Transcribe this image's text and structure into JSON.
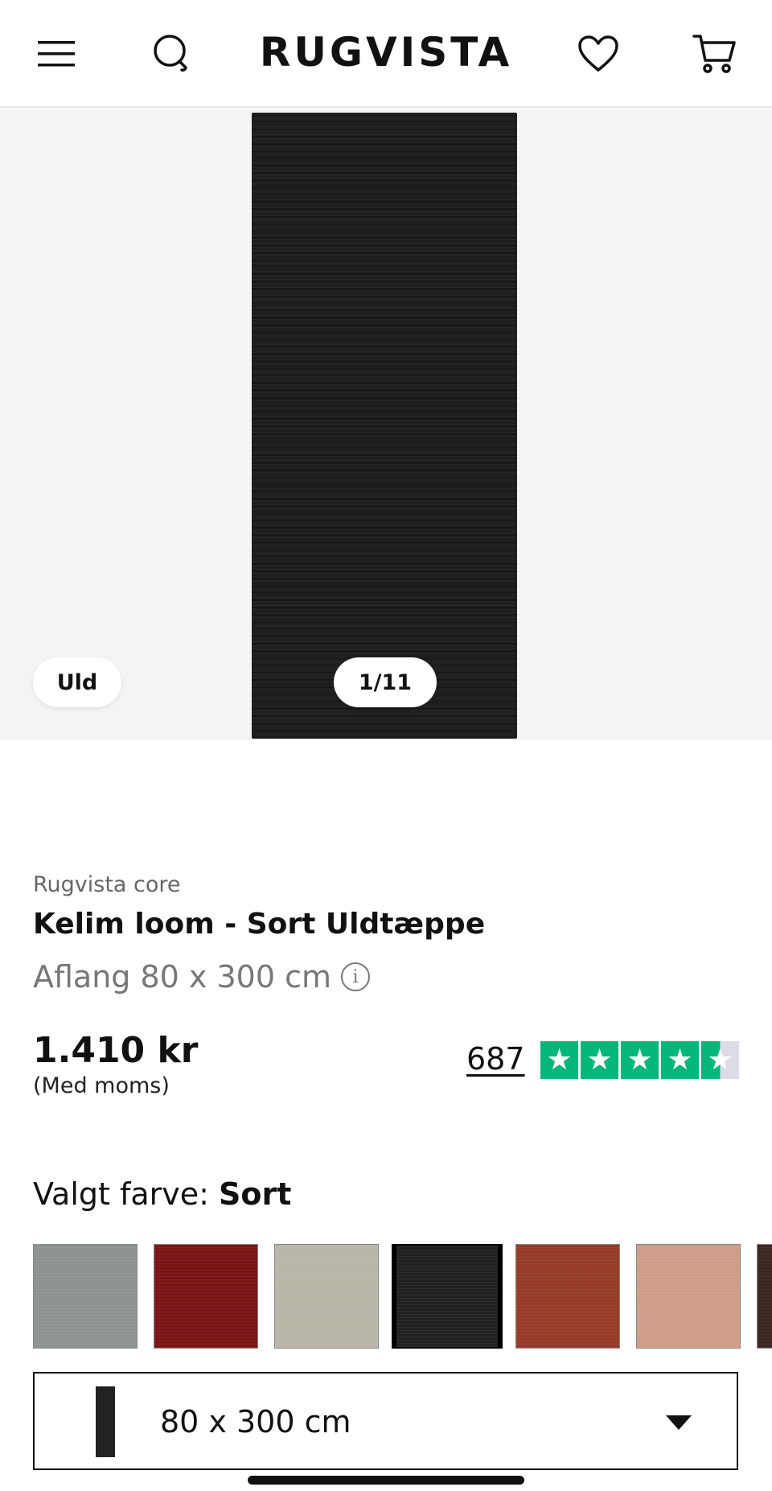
{
  "header": {
    "logo": "RUGVISTA",
    "icons": [
      "menu-icon",
      "search-icon",
      "heart-icon",
      "cart-icon"
    ]
  },
  "gallery": {
    "material_badge": "Uld",
    "counter": "1/11"
  },
  "product": {
    "brand": "Rugvista core",
    "title": "Kelim loom - Sort Uldtæppe",
    "size_line": "Aflang 80 x 300 cm",
    "info_icon": "i",
    "price": "1.410 kr",
    "vat_note": "(Med moms)",
    "review_count": "687",
    "rating_stars": 4.5,
    "rating_color": "#00b67a"
  },
  "color": {
    "label": "Valgt farve:",
    "selected": "Sort",
    "swatches": [
      {
        "name": "grey",
        "color": "#8d9292",
        "selected": false
      },
      {
        "name": "red",
        "color": "#7a1414",
        "selected": false
      },
      {
        "name": "beige",
        "color": "#b9b6a8",
        "selected": false
      },
      {
        "name": "black",
        "color": "#202120",
        "selected": true
      },
      {
        "name": "rust",
        "color": "#963b29",
        "selected": false
      },
      {
        "name": "peach",
        "color": "#cf9c86",
        "selected": false
      },
      {
        "name": "brown",
        "color": "#3b2620",
        "selected": false
      }
    ]
  },
  "size_selector": {
    "value": "80 x 300 cm"
  }
}
